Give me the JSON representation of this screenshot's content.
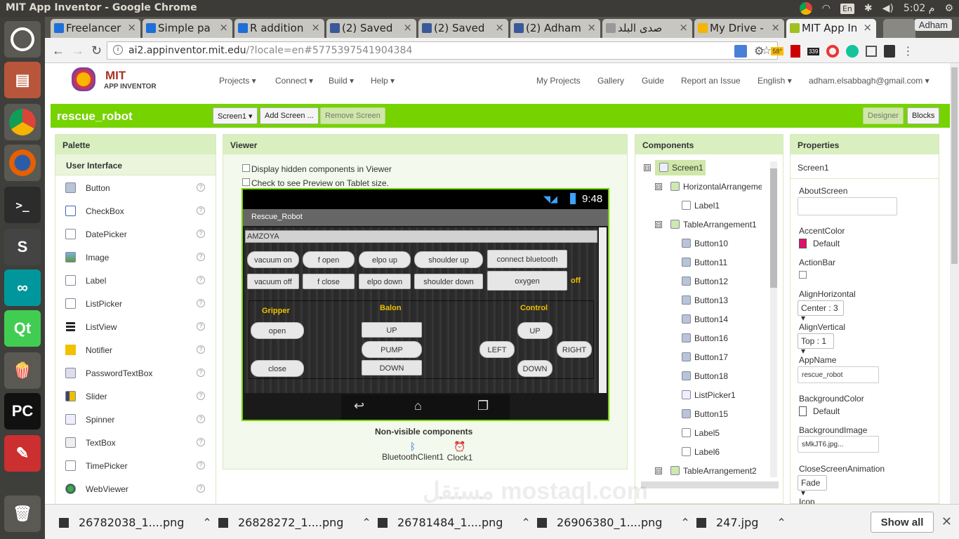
{
  "os": {
    "window_title": "MIT App Inventor - Google Chrome",
    "keyboard_lang": "En",
    "time": "5:02 م"
  },
  "tabs": [
    {
      "label": "Freelancer",
      "icon_color": "#1e6fd8"
    },
    {
      "label": "Simple pa",
      "icon_color": "#1e6fd8"
    },
    {
      "label": "R addition",
      "icon_color": "#1e6fd8"
    },
    {
      "label": "(2) Saved",
      "icon_color": "#3b5998"
    },
    {
      "label": "(2) Saved",
      "icon_color": "#3b5998"
    },
    {
      "label": "(2) Adham",
      "icon_color": "#3b5998"
    },
    {
      "label": "صدى البلد",
      "icon_color": "#999999"
    },
    {
      "label": "My Drive -",
      "icon_color": "#f4b400"
    },
    {
      "label": "MIT App In",
      "icon_color": "#a0c020"
    }
  ],
  "profile": "Adham",
  "url": {
    "host": "ai2.appinventor.mit.edu",
    "rest": "/?locale=en#5775397541904384"
  },
  "extensions": {
    "weather": "58°",
    "counter": "339"
  },
  "app": {
    "logo_line1": "MIT",
    "logo_line2": "APP INVENTOR",
    "menu": [
      "Projects ▾",
      "Connect ▾",
      "Build ▾",
      "Help ▾"
    ],
    "right_links": [
      "My Projects",
      "Gallery",
      "Guide",
      "Report an Issue",
      "English ▾",
      "adham.elsabbagh@gmail.com ▾"
    ]
  },
  "project": {
    "name": "rescue_robot",
    "screen_select": "Screen1 ▾",
    "add_screen": "Add Screen ...",
    "remove_screen": "Remove Screen",
    "designer": "Designer",
    "blocks": "Blocks"
  },
  "palette": {
    "title": "Palette",
    "section": "User Interface",
    "items": [
      {
        "label": "Button",
        "icon": "button-icon"
      },
      {
        "label": "CheckBox",
        "icon": "checkbox-icon"
      },
      {
        "label": "DatePicker",
        "icon": "datepicker-icon"
      },
      {
        "label": "Image",
        "icon": "image-icon"
      },
      {
        "label": "Label",
        "icon": "label-icon"
      },
      {
        "label": "ListPicker",
        "icon": "listpicker-icon"
      },
      {
        "label": "ListView",
        "icon": "listview-icon"
      },
      {
        "label": "Notifier",
        "icon": "notifier-icon"
      },
      {
        "label": "PasswordTextBox",
        "icon": "passwordtextbox-icon"
      },
      {
        "label": "Slider",
        "icon": "slider-icon"
      },
      {
        "label": "Spinner",
        "icon": "spinner-icon"
      },
      {
        "label": "TextBox",
        "icon": "textbox-icon"
      },
      {
        "label": "TimePicker",
        "icon": "timepicker-icon"
      },
      {
        "label": "WebViewer",
        "icon": "webviewer-icon"
      }
    ],
    "help": "?"
  },
  "viewer": {
    "title": "Viewer",
    "opt_hidden": "Display hidden components in Viewer",
    "opt_tablet": "Check to see Preview on Tablet size.",
    "clock": "9:48",
    "screen_title": "Rescue_Robot",
    "label_text": "AMZOYA",
    "row1": [
      "vacuum on",
      "f open",
      "elpo up",
      "shoulder up",
      "connect bluetooth"
    ],
    "row2": [
      "vacuum off",
      "f close",
      "elpo down",
      "shoulder down",
      "oxygen"
    ],
    "oxygen_status": "off",
    "gripper": "Gripper",
    "balon": "Balon",
    "control": "Control",
    "open": "open",
    "close": "close",
    "balon_up": "UP",
    "pump": "PUMP",
    "balon_down": "DOWN",
    "ctrl_up": "UP",
    "left": "LEFT",
    "right": "RIGHT",
    "ctrl_down": "DOWN",
    "nonvisible_title": "Non-visible components",
    "nonvisible": [
      "BluetoothClient1",
      "Clock1"
    ]
  },
  "components": {
    "title": "Components",
    "toggle_open": "⊟",
    "tree": [
      {
        "label": "Screen1",
        "level": 0,
        "toggle": true,
        "selected": true
      },
      {
        "label": "HorizontalArrangemen",
        "level": 1,
        "toggle": true
      },
      {
        "label": "Label1",
        "level": 2,
        "toggle": false
      },
      {
        "label": "TableArrangement1",
        "level": 1,
        "toggle": true
      },
      {
        "label": "Button10",
        "level": 2,
        "toggle": false
      },
      {
        "label": "Button11",
        "level": 2,
        "toggle": false
      },
      {
        "label": "Button12",
        "level": 2,
        "toggle": false
      },
      {
        "label": "Button13",
        "level": 2,
        "toggle": false
      },
      {
        "label": "Button14",
        "level": 2,
        "toggle": false
      },
      {
        "label": "Button16",
        "level": 2,
        "toggle": false
      },
      {
        "label": "Button17",
        "level": 2,
        "toggle": false
      },
      {
        "label": "Button18",
        "level": 2,
        "toggle": false
      },
      {
        "label": "ListPicker1",
        "level": 2,
        "toggle": false
      },
      {
        "label": "Button15",
        "level": 2,
        "toggle": false
      },
      {
        "label": "Label5",
        "level": 2,
        "toggle": false
      },
      {
        "label": "Label6",
        "level": 2,
        "toggle": false
      },
      {
        "label": "TableArrangement2",
        "level": 1,
        "toggle": true
      }
    ]
  },
  "properties": {
    "title": "Properties",
    "component": "Screen1",
    "about_label": "AboutScreen",
    "accent_label": "AccentColor",
    "accent_value": "Default",
    "accent_color": "#e0106a",
    "actionbar_label": "ActionBar",
    "alignh_label": "AlignHorizontal",
    "alignh_value": "Center : 3 ▾",
    "alignv_label": "AlignVertical",
    "alignv_value": "Top : 1 ▾",
    "appname_label": "AppName",
    "appname_value": "rescue_robot",
    "bgcolor_label": "BackgroundColor",
    "bgcolor_value": "Default",
    "bgimage_label": "BackgroundImage",
    "bgimage_value": "sMkJT6.jpg...",
    "closeanim_label": "CloseScreenAnimation",
    "closeanim_value": "Fade ▾",
    "icon_label": "Icon"
  },
  "downloads": [
    {
      "name": "26782038_1....png"
    },
    {
      "name": "26828272_1....png"
    },
    {
      "name": "26781484_1....png"
    },
    {
      "name": "26906380_1....png"
    },
    {
      "name": "247.jpg"
    }
  ],
  "downloads_showall": "Show all",
  "downloads_close": "✕",
  "watermark": "مستقل mostaql.com",
  "colors": {
    "accent_green": "#76d300",
    "panel_head": "#d9efc0",
    "warning_yellow": "#f0c000"
  }
}
